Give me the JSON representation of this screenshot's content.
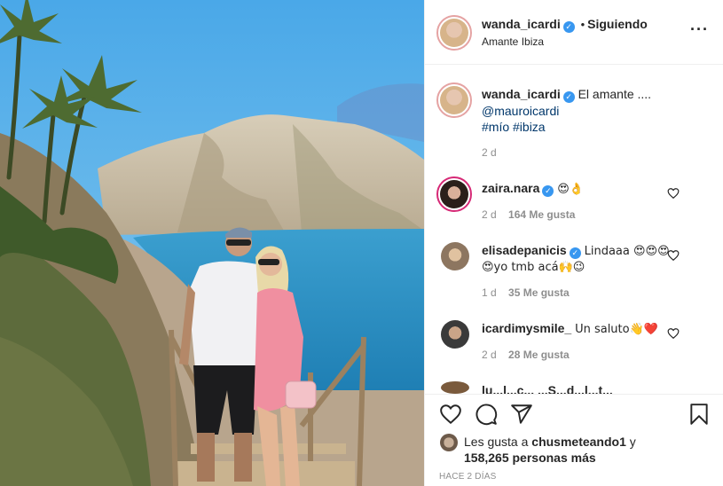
{
  "header": {
    "username": "wanda_icardi",
    "separator": "•",
    "follow_label": "Siguiendo",
    "location": "Amante Ibiza",
    "more_icon": "ellipsis-icon"
  },
  "caption": {
    "username": "wanda_icardi",
    "text": "El amante ....",
    "mention": "@mauroicardi",
    "hashtags": "#mío #ibiza",
    "time": "2 d"
  },
  "comments": [
    {
      "username": "zaira.nara",
      "verified": true,
      "text": "😍👌",
      "time": "2 d",
      "likes": "164 Me gusta"
    },
    {
      "username": "elisadepanicis",
      "verified": true,
      "text": "Lindaaa 😍😍😍",
      "text2": "😍yo tmb acá🙌😉",
      "time": "1 d",
      "likes": "35 Me gusta"
    },
    {
      "username": "icardimysmile_",
      "verified": false,
      "text": "Un saluto👋❤️",
      "time": "2 d",
      "likes": "28 Me gusta"
    }
  ],
  "cutoff_comment": "lu...l...c... ...S...d...l...t...",
  "actions": {
    "like_icon": "heart-icon",
    "comment_icon": "comment-icon",
    "share_icon": "share-icon",
    "save_icon": "bookmark-icon"
  },
  "likes": {
    "prefix": "Les gusta a",
    "user": "chusmeteando1",
    "conj": "y",
    "count": "158,265 personas más"
  },
  "timestamp": "HACE 2 DÍAS",
  "colors": {
    "verified": "#3897f0",
    "link": "#00376b",
    "muted": "#8e8e8e",
    "border": "#efefef"
  }
}
